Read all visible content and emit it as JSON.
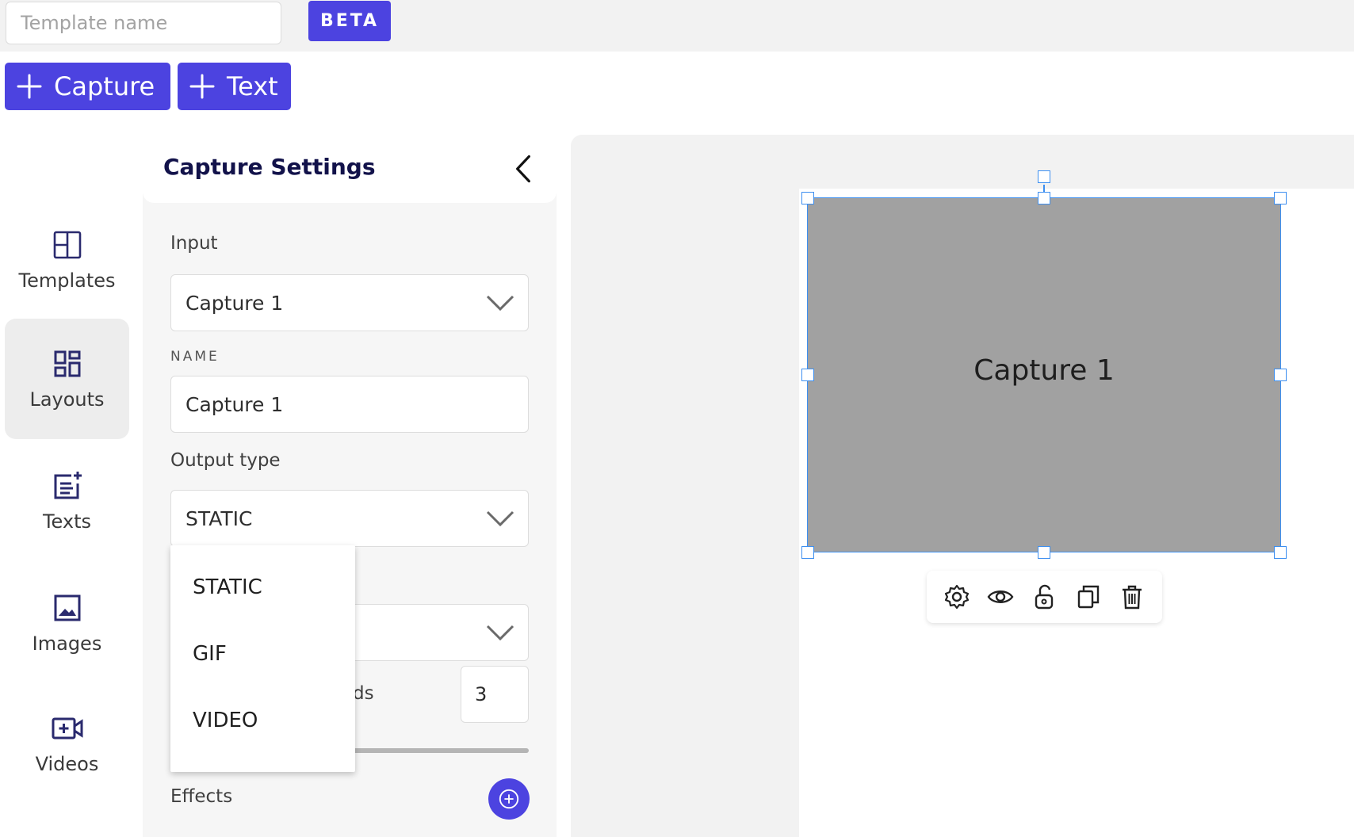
{
  "header": {
    "template_name_placeholder": "Template name",
    "template_name_value": "",
    "beta_label": "BETA"
  },
  "add_buttons": {
    "capture_label": "Capture",
    "text_label": "Text"
  },
  "nav": {
    "items": [
      {
        "label": "Templates",
        "icon": "templates-icon",
        "active": false
      },
      {
        "label": "Layouts",
        "icon": "layouts-icon",
        "active": true
      },
      {
        "label": "Texts",
        "icon": "texts-icon",
        "active": false
      },
      {
        "label": "Images",
        "icon": "images-icon",
        "active": false
      },
      {
        "label": "Videos",
        "icon": "videos-icon",
        "active": false
      }
    ]
  },
  "settings": {
    "title": "Capture Settings",
    "input_label": "Input",
    "input_value": "Capture 1",
    "name_label": "NAME",
    "name_value": "Capture 1",
    "output_type_label": "Output type",
    "output_type_value": "STATIC",
    "partial_label": "ds",
    "number_value": "3",
    "effects_label": "Effects"
  },
  "output_type_menu": {
    "options": [
      "STATIC",
      "GIF",
      "VIDEO"
    ]
  },
  "canvas": {
    "capture_label": "Capture 1",
    "toolbar": [
      "gear-icon",
      "eye-icon",
      "unlock-icon",
      "duplicate-icon",
      "trash-icon"
    ]
  },
  "colors": {
    "accent": "#4c43e0",
    "selection": "#3d8ff0",
    "capture_fill": "#a1a1a1",
    "panel_title": "#12124a"
  }
}
